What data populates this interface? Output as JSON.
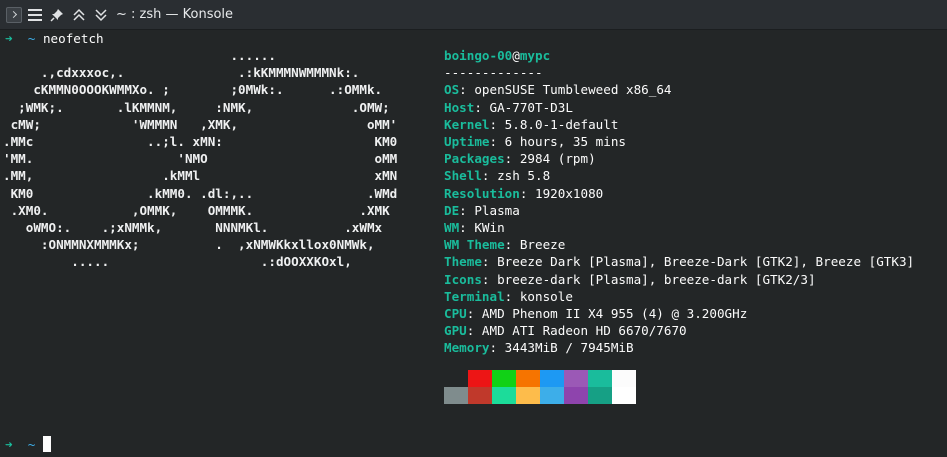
{
  "window": {
    "title": "~ : zsh — Konsole"
  },
  "prompt": {
    "arrow": "➜",
    "path": "~",
    "command": "neofetch"
  },
  "ascii_art": [
    "                              ......",
    "     .,cdxxxoc,.               .:kKMMMNWMMMNk:.",
    "    cKMMN0OOOKWMMXo. ;        ;0MWk:.      .:OMMk.",
    "  ;WMK;.       .lKMMNM,     :NMK,             .OMW;",
    " cMW;            'WMMMN   ,XMK,                 oMM'",
    ".MMc               ..;l. xMN:                    KM0",
    "'MM.                   'NMO                      oMM",
    ".MM,                 .kMMl                       xMN",
    " KM0               .kMM0. .dl:,..               .WMd",
    " .XM0.           ,OMMK,    OMMMK.              .XMK",
    "   oWMO:.    .;xNMMk,       NNNMKl.          .xWMx",
    "     :ONMMNXMMMKx;          .  ,xNMWKkxllox0NMWk,",
    "         .....                    .:dOOXXKOxl,"
  ],
  "info": {
    "user": "boingo-00",
    "at": "@",
    "host": "mypc",
    "separator": "-------------",
    "fields": [
      {
        "label": "OS",
        "value": "openSUSE Tumbleweed x86_64"
      },
      {
        "label": "Host",
        "value": "GA-770T-D3L"
      },
      {
        "label": "Kernel",
        "value": "5.8.0-1-default"
      },
      {
        "label": "Uptime",
        "value": "6 hours, 35 mins"
      },
      {
        "label": "Packages",
        "value": "2984 (rpm)"
      },
      {
        "label": "Shell",
        "value": "zsh 5.8"
      },
      {
        "label": "Resolution",
        "value": "1920x1080"
      },
      {
        "label": "DE",
        "value": "Plasma"
      },
      {
        "label": "WM",
        "value": "KWin"
      },
      {
        "label": "WM Theme",
        "value": "Breeze"
      },
      {
        "label": "Theme",
        "value": "Breeze Dark [Plasma], Breeze-Dark [GTK2], Breeze [GTK3]"
      },
      {
        "label": "Icons",
        "value": "breeze-dark [Plasma], breeze-dark [GTK2/3]"
      },
      {
        "label": "Terminal",
        "value": "konsole"
      },
      {
        "label": "CPU",
        "value": "AMD Phenom II X4 955 (4) @ 3.200GHz"
      },
      {
        "label": "GPU",
        "value": "AMD ATI Radeon HD 6670/7670"
      },
      {
        "label": "Memory",
        "value": "3443MiB / 7945MiB"
      }
    ],
    "colon": ": "
  },
  "palette": {
    "row1": [
      "#232627",
      "#ed1515",
      "#11d116",
      "#f67400",
      "#1d99f3",
      "#9b59b6",
      "#1abc9c",
      "#fcfcfc"
    ],
    "row2": [
      "#7f8c8d",
      "#c0392b",
      "#1cdc9a",
      "#fdbc4b",
      "#3daee9",
      "#8e44ad",
      "#16a085",
      "#ffffff"
    ]
  },
  "colors": {
    "accent": "#1abc9c",
    "path": "#3daee9",
    "background": "#232627"
  }
}
